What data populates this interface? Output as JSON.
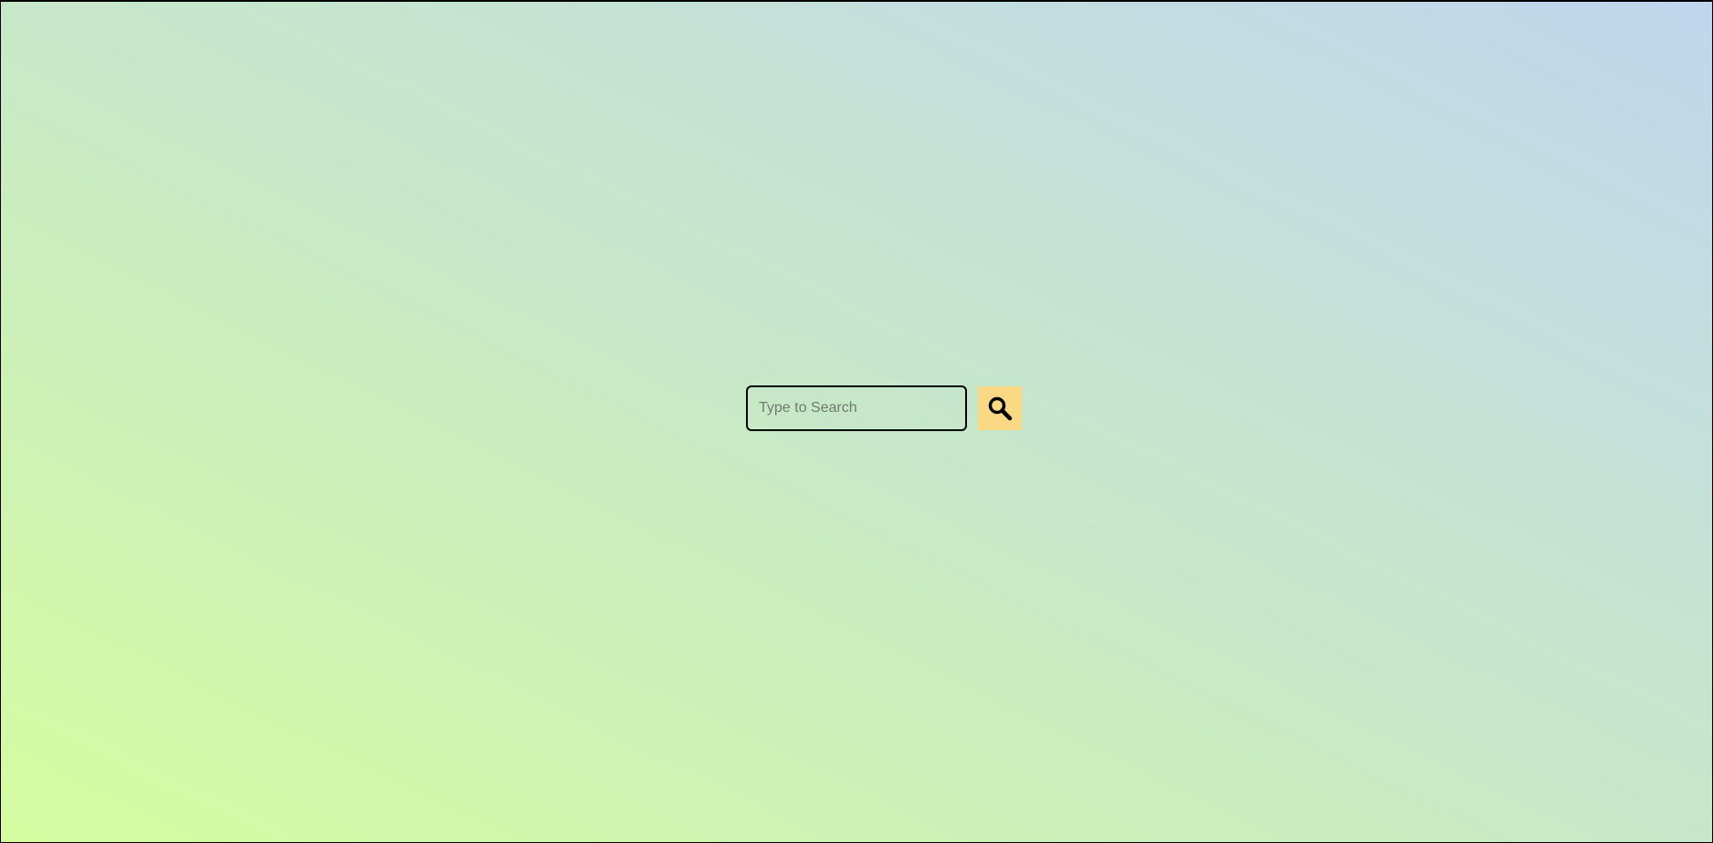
{
  "search": {
    "placeholder": "Type to Search",
    "value": "",
    "button_icon": "search-icon",
    "button_color": "#fbd984"
  },
  "background": {
    "gradient_start": "#d4fda0",
    "gradient_mid": "#c7e8c8",
    "gradient_end": "#c0d6ee"
  }
}
